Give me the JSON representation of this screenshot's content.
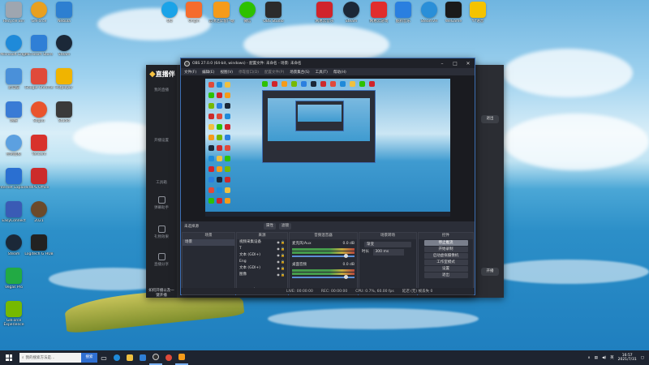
{
  "desktop_icons": [
    {
      "label": "Recycle Bin",
      "icon": "recycle-bin-icon",
      "color": "#9ea6b0"
    },
    {
      "label": "Microsoft Edge",
      "icon": "edge-icon",
      "color": "#1f8ad9"
    },
    {
      "label": "此电脑",
      "icon": "computer-icon",
      "color": "#4a90d9"
    },
    {
      "label": "网络",
      "icon": "network-icon",
      "color": "#3a7bd5"
    },
    {
      "label": "控制面板",
      "icon": "control-panel-icon",
      "color": "#5ca0e0"
    },
    {
      "label": "Internet Explorer",
      "icon": "ie-icon",
      "color": "#2a6fd1"
    },
    {
      "label": "EasyConnect",
      "icon": "easyconnect-icon",
      "color": "#3a5bb5"
    },
    {
      "label": "Steam",
      "icon": "steam-icon",
      "color": "#1b2838"
    },
    {
      "label": "Vegas Pro",
      "icon": "vegas-icon",
      "color": "#22aa44"
    },
    {
      "label": "GeForce Experience",
      "icon": "nvidia-icon",
      "color": "#76b900"
    },
    {
      "label": "GeForce",
      "icon": "geforce-icon",
      "color": "#e8a020"
    },
    {
      "label": "Microsoft Store",
      "icon": "store-icon",
      "color": "#2f7fd6"
    },
    {
      "label": "Google Chrome",
      "icon": "chrome-icon",
      "color": "#e04a3a"
    },
    {
      "label": "Sogou",
      "icon": "sogou-icon",
      "color": "#e9542d"
    },
    {
      "label": "Tencent",
      "icon": "tencent-icon",
      "color": "#d8322c"
    },
    {
      "label": "WPS Office",
      "icon": "wps-icon",
      "color": "#cc2b2b"
    },
    {
      "label": "2021",
      "icon": "photo-icon",
      "color": "#6b4a2b"
    },
    {
      "label": "Logitech G HUB",
      "icon": "ghub-icon",
      "color": "#222222"
    },
    {
      "label": "Nebula",
      "icon": "nebula-icon",
      "color": "#2d7fd1"
    },
    {
      "label": "Steam",
      "icon": "steam-icon-2",
      "color": "#1b2838"
    },
    {
      "label": "Potplayer",
      "icon": "player-icon",
      "color": "#f0b400"
    },
    {
      "label": "Studio",
      "icon": "studio-icon",
      "color": "#3a3a3a"
    },
    {
      "label": "QQ",
      "icon": "qq-icon",
      "color": "#1aa3e8"
    },
    {
      "label": "Origin",
      "icon": "origin-icon",
      "color": "#f56c2d"
    },
    {
      "label": "云顶之弈客户端",
      "icon": "game-icon",
      "color": "#f59b1a"
    },
    {
      "label": "微信",
      "icon": "wechat-icon",
      "color": "#2dc100"
    },
    {
      "label": "OBS Studio",
      "icon": "obs-icon",
      "color": "#2b2b2b"
    },
    {
      "label": "网易云音乐",
      "icon": "netease-icon",
      "color": "#d0242b"
    },
    {
      "label": "Steam",
      "icon": "steam-icon-3",
      "color": "#1b2838"
    },
    {
      "label": "网易云游戏",
      "icon": "netease-game-icon",
      "color": "#e02d2d"
    },
    {
      "label": "酷狗音乐",
      "icon": "kugou-icon",
      "color": "#2a7fe0"
    },
    {
      "label": "SteamVR",
      "icon": "steamvr-icon",
      "color": "#2a8fd8"
    },
    {
      "label": "WeGame",
      "icon": "wegame-icon",
      "color": "#1a1a1a"
    },
    {
      "label": "YY语音",
      "icon": "yy-icon",
      "color": "#f5c300"
    }
  ],
  "zhibo_app": {
    "logo_text": "直播伴",
    "menu": [
      "我的直播",
      "开播设置",
      "工具箱",
      "弹幕助手",
      "礼物效果",
      "直播分享"
    ],
    "right_buttons": [
      "退出",
      "开播"
    ],
    "bottom_text": "如何开播以及一键开播"
  },
  "obs": {
    "title": "OBS 27.0.0 (64-bit, windows) - 配置文件: 未命名 - 场景: 未命名",
    "menu": [
      "文件(F)",
      "编辑(E)",
      "视图(V)",
      "停靠窗口(D)",
      "配置文件(P)",
      "场景集合(S)",
      "工具(T)",
      "帮助(H)"
    ],
    "scene_bar": {
      "label": "未选择源",
      "properties": "属性",
      "filters": "滤镜"
    },
    "docks": {
      "scenes": {
        "title": "场景",
        "items": [
          "场景"
        ]
      },
      "sources": {
        "title": "来源",
        "items": [
          "视频采集设备",
          "T",
          "文本 (GDI+)",
          "Eng",
          "文本 (GDI+)",
          "图像"
        ]
      },
      "mixer": {
        "title": "音频混音器",
        "tracks": [
          {
            "name": "麦克风/Aux",
            "db": "0.0 dB"
          },
          {
            "name": "桌面音频",
            "db": "0.0 dB"
          }
        ]
      },
      "transitions": {
        "title": "场景转场",
        "type": "渐变",
        "duration_label": "时长",
        "duration": "300 ms"
      },
      "controls": {
        "title": "控件",
        "buttons": [
          "停止推流",
          "开始录制",
          "启动虚拟摄像机",
          "工作室模式",
          "设置",
          "退出"
        ]
      }
    },
    "status": {
      "live": "LIVE: 00:00:00",
      "rec": "REC: 00:00:00",
      "cpu": "CPU: 0.7%, 60.00 fps",
      "extra": "延迟 (无) 帧丢失 0"
    }
  },
  "taskbar": {
    "search_placeholder": "我的搜索方法是...",
    "search_button": "搜索",
    "language": "英",
    "time": "16:57",
    "date": "2021/7/31"
  }
}
